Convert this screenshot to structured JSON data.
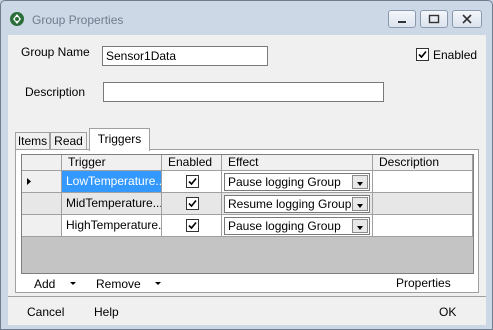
{
  "window": {
    "title": "Group Properties"
  },
  "form": {
    "group_name_label": "Group Name",
    "group_name_value": "Sensor1Data",
    "enabled_label": "Enabled",
    "enabled_checked": true,
    "description_label": "Description",
    "description_value": ""
  },
  "tabs": [
    {
      "label": "Items",
      "active": false
    },
    {
      "label": "Read",
      "active": false
    },
    {
      "label": "Triggers",
      "active": true
    }
  ],
  "grid": {
    "columns": [
      "Trigger",
      "Enabled",
      "Effect",
      "Description"
    ],
    "rows": [
      {
        "trigger": "LowTemperature...",
        "enabled": true,
        "effect": "Pause logging Group",
        "description": ""
      },
      {
        "trigger": "MidTemperature...",
        "enabled": true,
        "effect": "Resume logging Group",
        "description": ""
      },
      {
        "trigger": "HighTemperature...",
        "enabled": true,
        "effect": "Pause logging Group",
        "description": ""
      }
    ]
  },
  "toolbar": {
    "add_label": "Add",
    "remove_label": "Remove",
    "properties_label": "Properties"
  },
  "footer": {
    "cancel_label": "Cancel",
    "help_label": "Help",
    "ok_label": "OK"
  }
}
